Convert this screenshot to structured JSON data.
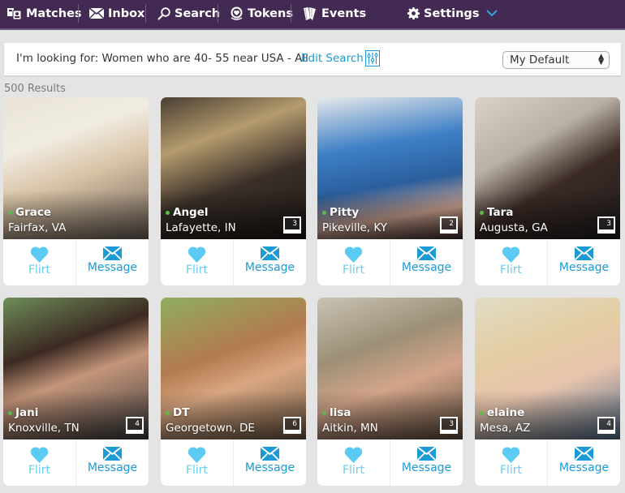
{
  "nav": {
    "items": [
      {
        "label": "Matches",
        "icon": "matches-icon"
      },
      {
        "label": "Inbox",
        "icon": "envelope-icon"
      },
      {
        "label": "Search",
        "icon": "search-icon"
      },
      {
        "label": "Tokens",
        "icon": "tokens-icon"
      },
      {
        "label": "Events",
        "icon": "tickets-icon"
      },
      {
        "label": "Settings",
        "icon": "gear-icon"
      }
    ],
    "settings_chevron": "chevron-down-icon"
  },
  "search": {
    "looking_for": "I'm looking for: Women who are 40- 55 near USA - All",
    "edit_label": "Edit Search",
    "sort_selected": "My Default"
  },
  "results_count": "500 Results",
  "colors": {
    "nav_bg": "#432a52",
    "accent": "#1b9ad6",
    "flirt": "#5ccbf4",
    "online": "#5cbd4a"
  },
  "actions": {
    "flirt": "Flirt",
    "message": "Message"
  },
  "profiles": [
    {
      "name": "Grace",
      "location": "Fairfax, VA",
      "photos": "",
      "online": true
    },
    {
      "name": "Angel",
      "location": "Lafayette, IN",
      "photos": "3",
      "online": true
    },
    {
      "name": "Pitty",
      "location": "Pikeville, KY",
      "photos": "2",
      "online": true
    },
    {
      "name": "Tara",
      "location": "Augusta, GA",
      "photos": "3",
      "online": true
    },
    {
      "name": "Jani",
      "location": "Knoxville, TN",
      "photos": "4",
      "online": true
    },
    {
      "name": "DT",
      "location": "Georgetown, DE",
      "photos": "6",
      "online": true
    },
    {
      "name": "lisa",
      "location": "Aitkin, MN",
      "photos": "3",
      "online": true
    },
    {
      "name": "elaine",
      "location": "Mesa, AZ",
      "photos": "4",
      "online": true
    }
  ]
}
